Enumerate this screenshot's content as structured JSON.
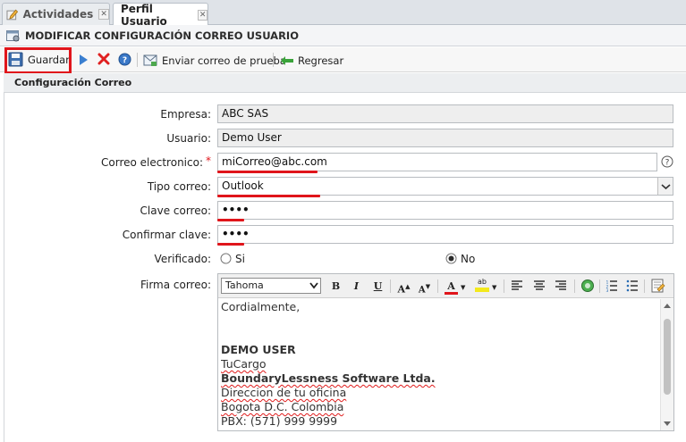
{
  "tabs": [
    {
      "label": "Actividades",
      "active": false
    },
    {
      "label": "Perfil Usuario",
      "active": true
    }
  ],
  "window": {
    "title": "MODIFICAR CONFIGURACIÓN CORREO USUARIO"
  },
  "toolbar": {
    "save_label": "Guardar",
    "send_test_label": "Enviar correo de prueba",
    "back_label": "Regresar"
  },
  "section": {
    "title": "Configuración Correo"
  },
  "form": {
    "empresa": {
      "label": "Empresa:",
      "value": "ABC SAS"
    },
    "usuario": {
      "label": "Usuario:",
      "value": "Demo User"
    },
    "correo": {
      "label": "Correo electronico:",
      "required_mark": "*",
      "value": "miCorreo@abc.com"
    },
    "tipo_correo": {
      "label": "Tipo correo:",
      "value": "Outlook"
    },
    "clave": {
      "label": "Clave correo:",
      "value": "••••"
    },
    "confirmar": {
      "label": "Confirmar clave:",
      "value": "••••"
    },
    "verificado": {
      "label": "Verificado:",
      "option_si": "Si",
      "option_no": "No",
      "selected": "No"
    },
    "firma": {
      "label": "Firma correo:",
      "font": "Tahoma",
      "lines": [
        "Cordialmente,",
        "",
        "",
        "DEMO USER",
        "TuCargo",
        "BoundaryLessness Software Ltda.",
        "Direccion de tu oficina",
        "Bogota D.C. Colombia",
        "PBX: (571) 999 9999"
      ]
    }
  },
  "colors": {
    "highlight": "#e0151b",
    "accent_blue": "#2a6db3"
  }
}
